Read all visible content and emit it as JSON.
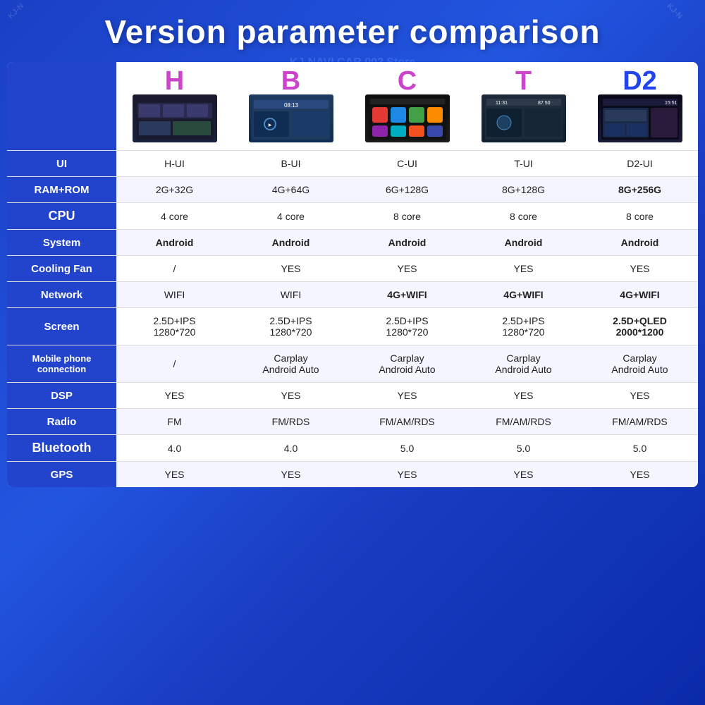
{
  "title": "Version parameter comparison",
  "watermark": "KJ-NAVI CAR 002 Store",
  "versions": [
    "H",
    "B",
    "C",
    "T",
    "D2"
  ],
  "version_styles": [
    "purple",
    "purple",
    "purple",
    "purple",
    "blue"
  ],
  "rows": [
    {
      "label": "UI",
      "label_style": "normal",
      "values": [
        "H-UI",
        "B-UI",
        "C-UI",
        "T-UI",
        "D2-UI"
      ],
      "type": "image"
    },
    {
      "label": "RAM+ROM",
      "label_style": "normal",
      "values": [
        "2G+32G",
        "4G+64G",
        "6G+128G",
        "8G+128G",
        "8G+256G"
      ],
      "value_styles": [
        "normal",
        "normal",
        "normal",
        "normal",
        "red"
      ]
    },
    {
      "label": "CPU",
      "label_style": "bold",
      "values": [
        "4 core",
        "4 core",
        "8 core",
        "8 core",
        "8 core"
      ],
      "value_styles": [
        "normal",
        "normal",
        "normal",
        "normal",
        "normal"
      ]
    },
    {
      "label": "System",
      "label_style": "normal",
      "values": [
        "Android",
        "Android",
        "Android",
        "Android",
        "Android"
      ],
      "value_styles": [
        "purple",
        "purple",
        "purple",
        "purple",
        "purple"
      ]
    },
    {
      "label": "Cooling Fan",
      "label_style": "normal",
      "values": [
        "/",
        "YES",
        "YES",
        "YES",
        "YES"
      ],
      "value_styles": [
        "normal",
        "normal",
        "normal",
        "normal",
        "normal"
      ]
    },
    {
      "label": "Network",
      "label_style": "normal",
      "values": [
        "WIFI",
        "WIFI",
        "4G+WIFI",
        "4G+WIFI",
        "4G+WIFI"
      ],
      "value_styles": [
        "normal",
        "normal",
        "red",
        "red",
        "red"
      ]
    },
    {
      "label": "Screen",
      "label_style": "normal",
      "values": [
        "2.5D+IPS\n1280*720",
        "2.5D+IPS\n1280*720",
        "2.5D+IPS\n1280*720",
        "2.5D+IPS\n1280*720",
        "2.5D+QLED\n2000*1200"
      ],
      "value_styles": [
        "normal",
        "normal",
        "normal",
        "normal",
        "red"
      ]
    },
    {
      "label": "Mobile phone connection",
      "label_style": "small",
      "values": [
        "/",
        "Carplay\nAndroid Auto",
        "Carplay\nAndroid Auto",
        "Carplay\nAndroid Auto",
        "Carplay\nAndroid Auto"
      ],
      "value_styles": [
        "normal",
        "normal",
        "normal",
        "normal",
        "normal"
      ]
    },
    {
      "label": "DSP",
      "label_style": "normal",
      "values": [
        "YES",
        "YES",
        "YES",
        "YES",
        "YES"
      ],
      "value_styles": [
        "normal",
        "normal",
        "normal",
        "normal",
        "normal"
      ]
    },
    {
      "label": "Radio",
      "label_style": "normal",
      "values": [
        "FM",
        "FM/RDS",
        "FM/AM/RDS",
        "FM/AM/RDS",
        "FM/AM/RDS"
      ],
      "value_styles": [
        "normal",
        "normal",
        "normal",
        "normal",
        "normal"
      ]
    },
    {
      "label": "Bluetooth",
      "label_style": "bold",
      "values": [
        "4.0",
        "4.0",
        "5.0",
        "5.0",
        "5.0"
      ],
      "value_styles": [
        "normal",
        "normal",
        "normal",
        "normal",
        "normal"
      ]
    },
    {
      "label": "GPS",
      "label_style": "normal",
      "values": [
        "YES",
        "YES",
        "YES",
        "YES",
        "YES"
      ],
      "value_styles": [
        "normal",
        "normal",
        "normal",
        "normal",
        "normal"
      ]
    }
  ]
}
